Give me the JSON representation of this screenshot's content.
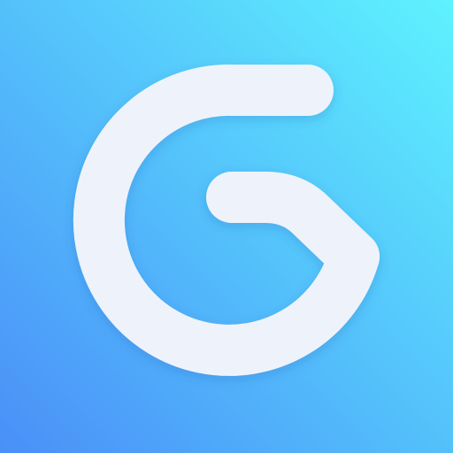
{
  "app_icon": {
    "glyph": "logo-g-icon",
    "colors": {
      "background_top_right": "#5ef2fe",
      "background_bottom_left": "#4a8ff8",
      "glyph_fill": "#eef3fb"
    }
  }
}
